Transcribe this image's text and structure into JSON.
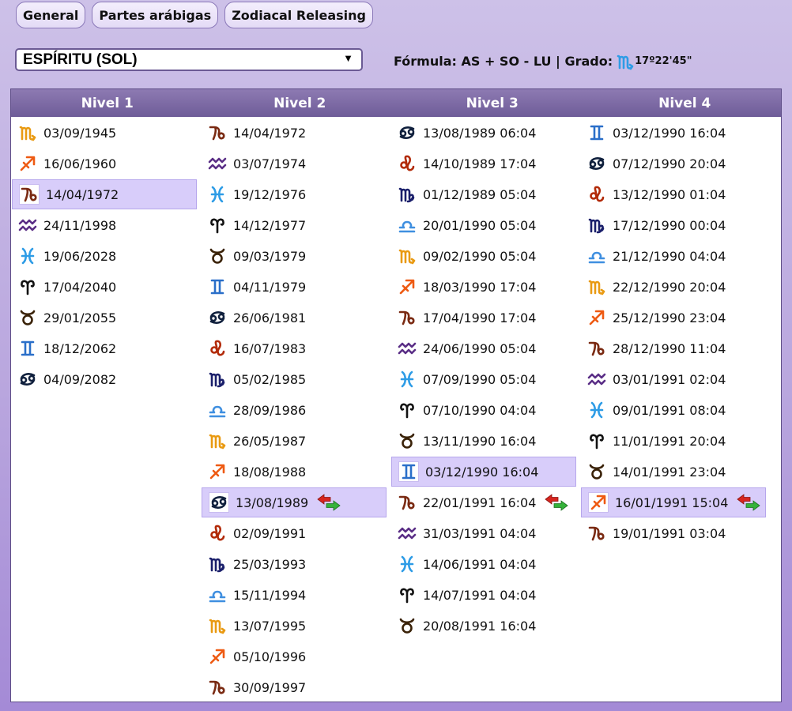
{
  "tabs": [
    "General",
    "Partes arábigas",
    "Zodiacal Releasing"
  ],
  "select": {
    "value": "ESPÍRITU (SOL)",
    "arrow": "▼"
  },
  "formula": {
    "label": "Fórmula: AS + SO - LU | Grado:",
    "sign": "scorpio",
    "degree": "17º22'45\""
  },
  "columns": [
    {
      "title": "Nivel 1",
      "rows": [
        {
          "sign": "scorpio",
          "date": "03/09/1945"
        },
        {
          "sign": "sagittarius",
          "date": "16/06/1960"
        },
        {
          "sign": "capricorn",
          "date": "14/04/1972",
          "selected": true
        },
        {
          "sign": "aquarius",
          "date": "24/11/1998"
        },
        {
          "sign": "pisces",
          "date": "19/06/2028"
        },
        {
          "sign": "aries",
          "date": "17/04/2040"
        },
        {
          "sign": "taurus",
          "date": "29/01/2055"
        },
        {
          "sign": "gemini",
          "date": "18/12/2062"
        },
        {
          "sign": "cancer",
          "date": "04/09/2082"
        }
      ]
    },
    {
      "title": "Nivel 2",
      "rows": [
        {
          "sign": "capricorn",
          "date": "14/04/1972"
        },
        {
          "sign": "aquarius",
          "date": "03/07/1974"
        },
        {
          "sign": "pisces",
          "date": "19/12/1976"
        },
        {
          "sign": "aries",
          "date": "14/12/1977"
        },
        {
          "sign": "taurus",
          "date": "09/03/1979"
        },
        {
          "sign": "gemini",
          "date": "04/11/1979"
        },
        {
          "sign": "cancer",
          "date": "26/06/1981"
        },
        {
          "sign": "leo",
          "date": "16/07/1983"
        },
        {
          "sign": "virgo",
          "date": "05/02/1985"
        },
        {
          "sign": "libra",
          "date": "28/09/1986"
        },
        {
          "sign": "scorpio",
          "date": "26/05/1987"
        },
        {
          "sign": "sagittarius",
          "date": "18/08/1988"
        },
        {
          "sign": "cancer",
          "date": "13/08/1989",
          "selected": true,
          "swap": true
        },
        {
          "sign": "leo",
          "date": "02/09/1991"
        },
        {
          "sign": "virgo",
          "date": "25/03/1993"
        },
        {
          "sign": "libra",
          "date": "15/11/1994"
        },
        {
          "sign": "scorpio",
          "date": "13/07/1995"
        },
        {
          "sign": "sagittarius",
          "date": "05/10/1996"
        },
        {
          "sign": "capricorn",
          "date": "30/09/1997"
        }
      ]
    },
    {
      "title": "Nivel 3",
      "rows": [
        {
          "sign": "cancer",
          "date": "13/08/1989 06:04"
        },
        {
          "sign": "leo",
          "date": "14/10/1989 17:04"
        },
        {
          "sign": "virgo",
          "date": "01/12/1989 05:04"
        },
        {
          "sign": "libra",
          "date": "20/01/1990 05:04"
        },
        {
          "sign": "scorpio",
          "date": "09/02/1990 05:04"
        },
        {
          "sign": "sagittarius",
          "date": "18/03/1990 17:04"
        },
        {
          "sign": "capricorn",
          "date": "17/04/1990 17:04"
        },
        {
          "sign": "aquarius",
          "date": "24/06/1990 05:04"
        },
        {
          "sign": "pisces",
          "date": "07/09/1990 05:04"
        },
        {
          "sign": "aries",
          "date": "07/10/1990 04:04"
        },
        {
          "sign": "taurus",
          "date": "13/11/1990 16:04"
        },
        {
          "sign": "gemini",
          "date": "03/12/1990 16:04",
          "selected": true
        },
        {
          "sign": "capricorn",
          "date": "22/01/1991 16:04",
          "swap": true
        },
        {
          "sign": "aquarius",
          "date": "31/03/1991 04:04"
        },
        {
          "sign": "pisces",
          "date": "14/06/1991 04:04"
        },
        {
          "sign": "aries",
          "date": "14/07/1991 04:04"
        },
        {
          "sign": "taurus",
          "date": "20/08/1991 16:04"
        }
      ]
    },
    {
      "title": "Nivel 4",
      "rows": [
        {
          "sign": "gemini",
          "date": "03/12/1990 16:04"
        },
        {
          "sign": "cancer",
          "date": "07/12/1990 20:04"
        },
        {
          "sign": "leo",
          "date": "13/12/1990 01:04"
        },
        {
          "sign": "virgo",
          "date": "17/12/1990 00:04"
        },
        {
          "sign": "libra",
          "date": "21/12/1990 04:04"
        },
        {
          "sign": "scorpio",
          "date": "22/12/1990 20:04"
        },
        {
          "sign": "sagittarius",
          "date": "25/12/1990 23:04"
        },
        {
          "sign": "capricorn",
          "date": "28/12/1990 11:04"
        },
        {
          "sign": "aquarius",
          "date": "03/01/1991 02:04"
        },
        {
          "sign": "pisces",
          "date": "09/01/1991 08:04"
        },
        {
          "sign": "aries",
          "date": "11/01/1991 20:04"
        },
        {
          "sign": "taurus",
          "date": "14/01/1991 23:04"
        },
        {
          "sign": "sagittarius",
          "date": "16/01/1991 15:04",
          "selected": true,
          "swap": true
        },
        {
          "sign": "capricorn",
          "date": "19/01/1991 03:04"
        }
      ]
    }
  ],
  "sign_colors": {
    "aries": "#111111",
    "taurus": "#3a2208",
    "gemini": "#2a6fc9",
    "cancer": "#10203d",
    "leo": "#b22a08",
    "virgo": "#1a1f6b",
    "libra": "#3f8fe0",
    "scorpio": "#e99a12",
    "sagittarius": "#ee5a12",
    "capricorn": "#7a2a12",
    "aquarius": "#5a2e86",
    "pisces": "#2e9ce6"
  }
}
